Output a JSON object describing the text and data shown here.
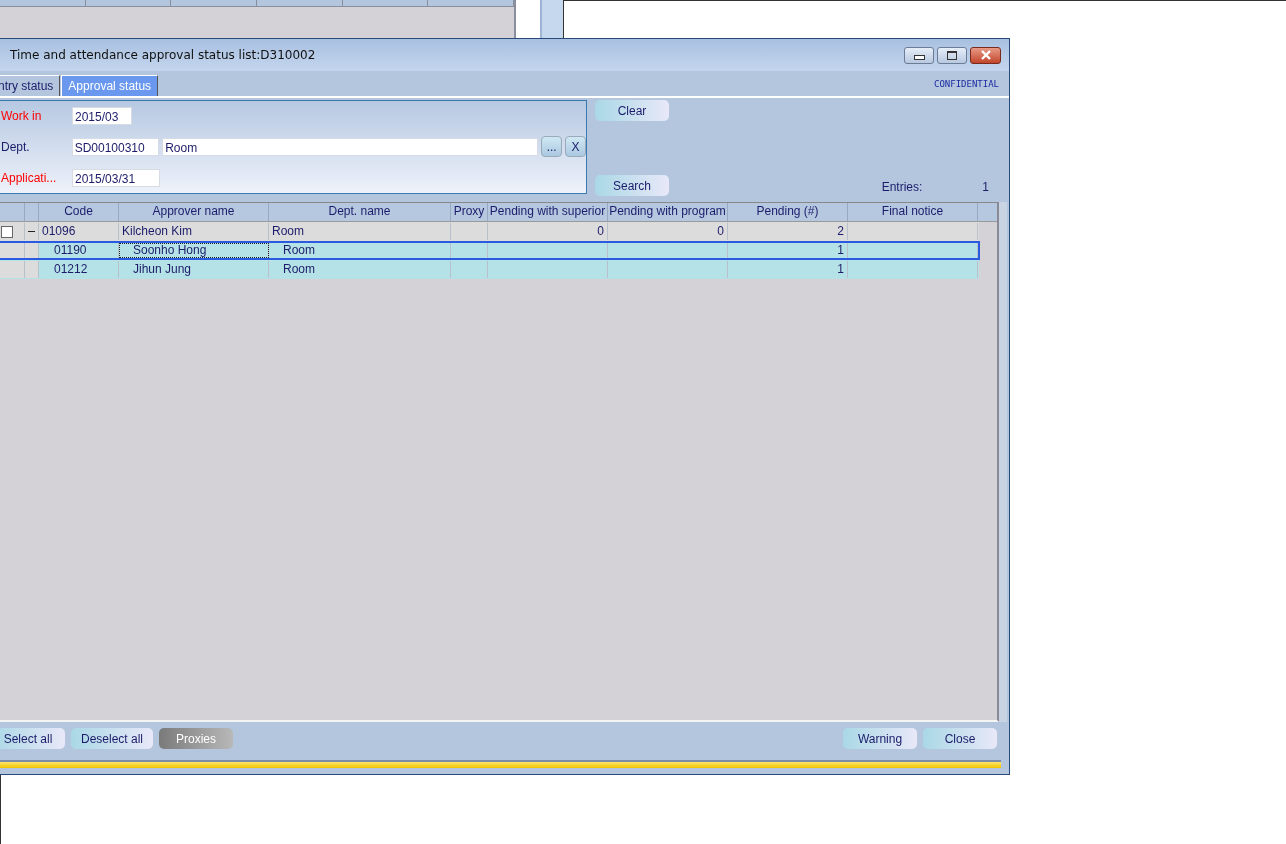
{
  "window": {
    "title": "Time and attendance approval status list:D310002"
  },
  "tabs": [
    {
      "label": "ntry status",
      "selected": false
    },
    {
      "label": "Approval status",
      "selected": true
    }
  ],
  "classification": "CONFIDENTIAL",
  "filters": [
    {
      "kind": "single",
      "label": "Work in",
      "required": true,
      "value": "2015/03"
    },
    {
      "kind": "lookup",
      "label": "Dept.",
      "required": false,
      "code": "SD00100310",
      "name": "Room",
      "browse": "...",
      "clear": "X"
    },
    {
      "kind": "single",
      "label": "Applicati...",
      "required": true,
      "value": "2015/03/31"
    }
  ],
  "clear_button": "Clear",
  "search_button": "Search",
  "entries": {
    "label": "Entries:",
    "value": "1"
  },
  "table": {
    "columns": [
      "Code",
      "Approver name",
      "Dept. name",
      "Proxy",
      "Pending with superior",
      "Pending with program",
      "Pending (#)",
      "Final notice"
    ],
    "rows": [
      {
        "kind": "group",
        "checked": false,
        "expanded": true,
        "selected": false,
        "code": "01096",
        "approver": "Kilcheon Kim",
        "dept": "Room",
        "pending_superior": "0",
        "pending_program": "0",
        "pending": "2"
      },
      {
        "kind": "member",
        "selected": true,
        "code": "01190",
        "approver": "Soonho Hong",
        "dept": "Room",
        "pending": "1"
      },
      {
        "kind": "member",
        "selected": false,
        "code": "01212",
        "approver": "Jihun Jung",
        "dept": "Room",
        "pending": "1"
      }
    ]
  },
  "footer_left": [
    {
      "label": "Select all",
      "disabled": false
    },
    {
      "label": "Deselect all",
      "disabled": false
    },
    {
      "label": "Proxies",
      "disabled": true
    }
  ],
  "footer_right": [
    {
      "label": "Warning",
      "disabled": false
    },
    {
      "label": "Close",
      "disabled": false
    }
  ]
}
